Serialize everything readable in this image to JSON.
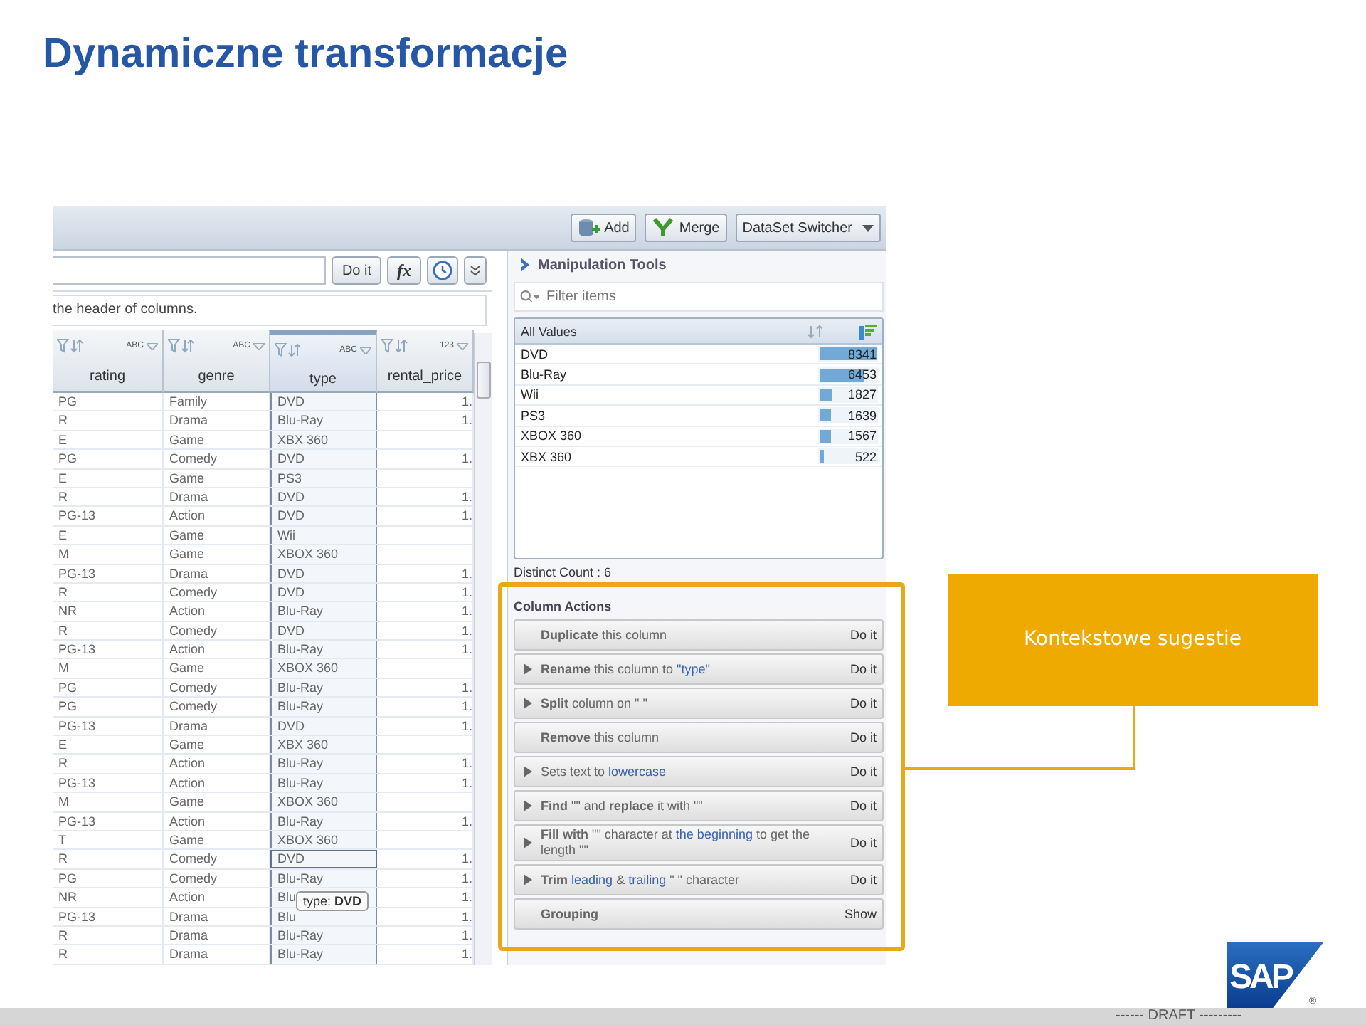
{
  "slide_title": "Dynamiczne transformacje",
  "toolbar": {
    "buttons": [
      {
        "kind": "add",
        "label": "Add"
      },
      {
        "kind": "merge",
        "label": "Merge"
      },
      {
        "kind": "dropdown",
        "label": "DataSet Switcher"
      }
    ]
  },
  "command_bar": {
    "run_button": "Do it",
    "formula_button": "fx"
  },
  "hint": "the header of columns.",
  "table": {
    "columns": [
      {
        "name": "rating",
        "type_label": "ABC",
        "selected": false
      },
      {
        "name": "genre",
        "type_label": "ABC",
        "selected": false
      },
      {
        "name": "type",
        "type_label": "ABC",
        "selected": true
      },
      {
        "name": "rental_price",
        "type_label": "123",
        "selected": false
      }
    ],
    "rows": [
      {
        "cells": [
          "PG",
          "Family",
          "DVD",
          "1."
        ],
        "selected": false
      },
      {
        "cells": [
          "R",
          "Drama",
          "Blu-Ray",
          "1."
        ],
        "selected": false
      },
      {
        "cells": [
          "E",
          "Game",
          "XBX 360"
        ],
        "selected": false
      },
      {
        "cells": [
          "PG",
          "Comedy",
          "DVD",
          "1."
        ],
        "selected": false
      },
      {
        "cells": [
          "E",
          "Game",
          "PS3"
        ],
        "selected": false
      },
      {
        "cells": [
          "R",
          "Drama",
          "DVD",
          "1."
        ],
        "selected": false
      },
      {
        "cells": [
          "PG-13",
          "Action",
          "DVD",
          "1."
        ],
        "selected": false
      },
      {
        "cells": [
          "E",
          "Game",
          "Wii"
        ],
        "selected": false
      },
      {
        "cells": [
          "M",
          "Game",
          "XBOX 360"
        ],
        "selected": false
      },
      {
        "cells": [
          "PG-13",
          "Drama",
          "DVD",
          "1."
        ],
        "selected": false
      },
      {
        "cells": [
          "R",
          "Comedy",
          "DVD",
          "1."
        ],
        "selected": false
      },
      {
        "cells": [
          "NR",
          "Action",
          "Blu-Ray",
          "1."
        ],
        "selected": false
      },
      {
        "cells": [
          "R",
          "Comedy",
          "DVD",
          "1."
        ],
        "selected": false
      },
      {
        "cells": [
          "PG-13",
          "Action",
          "Blu-Ray",
          "1."
        ],
        "selected": false
      },
      {
        "cells": [
          "M",
          "Game",
          "XBOX 360"
        ],
        "selected": false
      },
      {
        "cells": [
          "PG",
          "Comedy",
          "Blu-Ray",
          "1."
        ],
        "selected": false
      },
      {
        "cells": [
          "PG",
          "Comedy",
          "Blu-Ray",
          "1."
        ],
        "selected": false
      },
      {
        "cells": [
          "PG-13",
          "Drama",
          "DVD",
          "1."
        ],
        "selected": false
      },
      {
        "cells": [
          "E",
          "Game",
          "XBX 360"
        ],
        "selected": false
      },
      {
        "cells": [
          "R",
          "Action",
          "Blu-Ray",
          "1."
        ],
        "selected": false
      },
      {
        "cells": [
          "PG-13",
          "Action",
          "Blu-Ray",
          "1."
        ],
        "selected": false
      },
      {
        "cells": [
          "M",
          "Game",
          "XBOX 360"
        ],
        "selected": false
      },
      {
        "cells": [
          "PG-13",
          "Action",
          "Blu-Ray",
          "1."
        ],
        "selected": false
      },
      {
        "cells": [
          "T",
          "Game",
          "XBOX 360"
        ],
        "selected": false
      },
      {
        "cells": [
          "R",
          "Comedy",
          "DVD",
          "1."
        ],
        "selected": true
      },
      {
        "cells": [
          "PG",
          "Comedy",
          "Blu-Ray",
          "1."
        ],
        "selected": false
      },
      {
        "cells": [
          "NR",
          "Action",
          "Blu",
          "1."
        ],
        "selected": false
      },
      {
        "cells": [
          "PG-13",
          "Drama",
          "Blu",
          "1."
        ],
        "selected": false
      },
      {
        "cells": [
          "R",
          "Drama",
          "Blu-Ray",
          "1."
        ],
        "selected": false
      },
      {
        "cells": [
          "R",
          "Drama",
          "Blu-Ray",
          "1."
        ],
        "selected": false
      }
    ],
    "tooltip": "type: **DVD**"
  },
  "manipulation_tools": {
    "title": "Manipulation Tools",
    "filter": {
      "placeholder": "Filter items"
    },
    "values_header": "All Values",
    "values": [
      {
        "name": "DVD",
        "count": "8341",
        "level": 1
      },
      {
        "name": "Blu-Ray",
        "count": "6453",
        "level": 0.774
      },
      {
        "name": "Wii",
        "count": "1827",
        "level": 0.219
      },
      {
        "name": "PS3",
        "count": "1639",
        "level": 0.197
      },
      {
        "name": "XBOX 360",
        "count": "1567",
        "level": 0.188
      },
      {
        "name": "XBX 360",
        "count": "522",
        "level": 0.063
      }
    ],
    "distinct_count": "Distinct Count : 6"
  },
  "column_actions": {
    "title": "Column Actions",
    "actions": [
      {
        "expandable": false,
        "parts": [
          {
            "text": "**Duplicate** this column",
            "kind": "text"
          }
        ],
        "button": "Do it"
      },
      {
        "expandable": true,
        "parts": [
          {
            "text": "**Rename** this column to ",
            "kind": "text"
          },
          {
            "text": "\"type\"",
            "kind": "link"
          }
        ],
        "button": "Do it"
      },
      {
        "expandable": true,
        "parts": [
          {
            "text": "**Split** column on \" \"",
            "kind": "text"
          }
        ],
        "button": "Do it"
      },
      {
        "expandable": false,
        "parts": [
          {
            "text": "**Remove** this column",
            "kind": "text"
          }
        ],
        "button": "Do it"
      },
      {
        "expandable": true,
        "parts": [
          {
            "text": "Sets text to ",
            "kind": "text"
          },
          {
            "text": "lowercase",
            "kind": "link"
          }
        ],
        "button": "Do it"
      },
      {
        "expandable": true,
        "parts": [
          {
            "text": "**Find** \"\" and **replace** it with \"\"",
            "kind": "text"
          }
        ],
        "button": "Do it"
      },
      {
        "expandable": true,
        "parts": [
          {
            "text": "**Fill with** \"\" character at ",
            "kind": "text"
          },
          {
            "text": "the beginning",
            "kind": "link"
          },
          {
            "text": " to get the length \"\"",
            "kind": "text"
          }
        ],
        "button": "Do it"
      },
      {
        "expandable": true,
        "parts": [
          {
            "text": "**Trim** ",
            "kind": "text"
          },
          {
            "text": "leading",
            "kind": "link"
          },
          {
            "text": " & ",
            "kind": "text"
          },
          {
            "text": "trailing",
            "kind": "link"
          },
          {
            "text": " \" \" character",
            "kind": "text"
          }
        ],
        "button": "Do it"
      },
      {
        "expandable": false,
        "parts": [
          {
            "text": "**Grouping**",
            "kind": "text"
          }
        ],
        "button": "Show"
      }
    ]
  },
  "callout": "Kontekstowe sugestie",
  "logo": {
    "text": "SAP",
    "mark": "®"
  },
  "footer": "------ DRAFT ---------"
}
